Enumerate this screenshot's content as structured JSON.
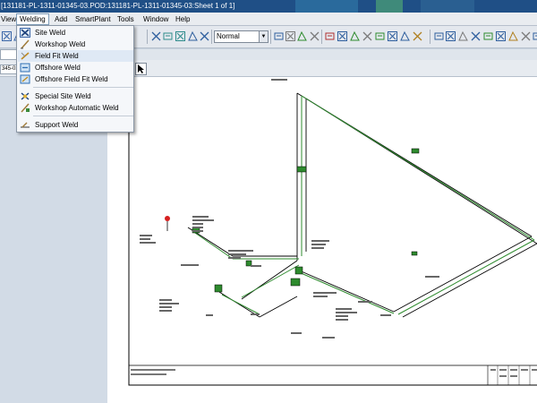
{
  "window": {
    "title": "[131181-PL-1311-01345-03.POD:131181-PL-1311-01345-03:Sheet 1 of 1]"
  },
  "menubar": {
    "items": [
      "View",
      "Welding",
      "Add",
      "SmartPlant",
      "Tools",
      "Window",
      "Help"
    ],
    "active": "Welding"
  },
  "toolbar": {
    "style_value": "Normal"
  },
  "document": {
    "tab_label": "",
    "field_value": "345-03"
  },
  "welding_menu": {
    "items": [
      {
        "label": "Site Weld",
        "icon": "site-weld-icon"
      },
      {
        "label": "Workshop Weld",
        "icon": "workshop-weld-icon"
      },
      {
        "label": "Field Fit Weld",
        "icon": "field-fit-weld-icon"
      },
      {
        "label": "Offshore Weld",
        "icon": "offshore-weld-icon"
      },
      {
        "label": "Offshore Field Fit Weld",
        "icon": "offshore-field-fit-weld-icon"
      },
      {
        "label": "Special Site Weld",
        "icon": "special-site-weld-icon"
      },
      {
        "label": "Workshop Automatic Weld",
        "icon": "workshop-automatic-weld-icon"
      },
      {
        "label": "Support Weld",
        "icon": "support-weld-icon"
      }
    ]
  },
  "colors": {
    "titlebar": "#1f4f86",
    "pipe_green": "#2e8b2e",
    "drawing_line": "#000000",
    "marker_red": "#d62020"
  }
}
